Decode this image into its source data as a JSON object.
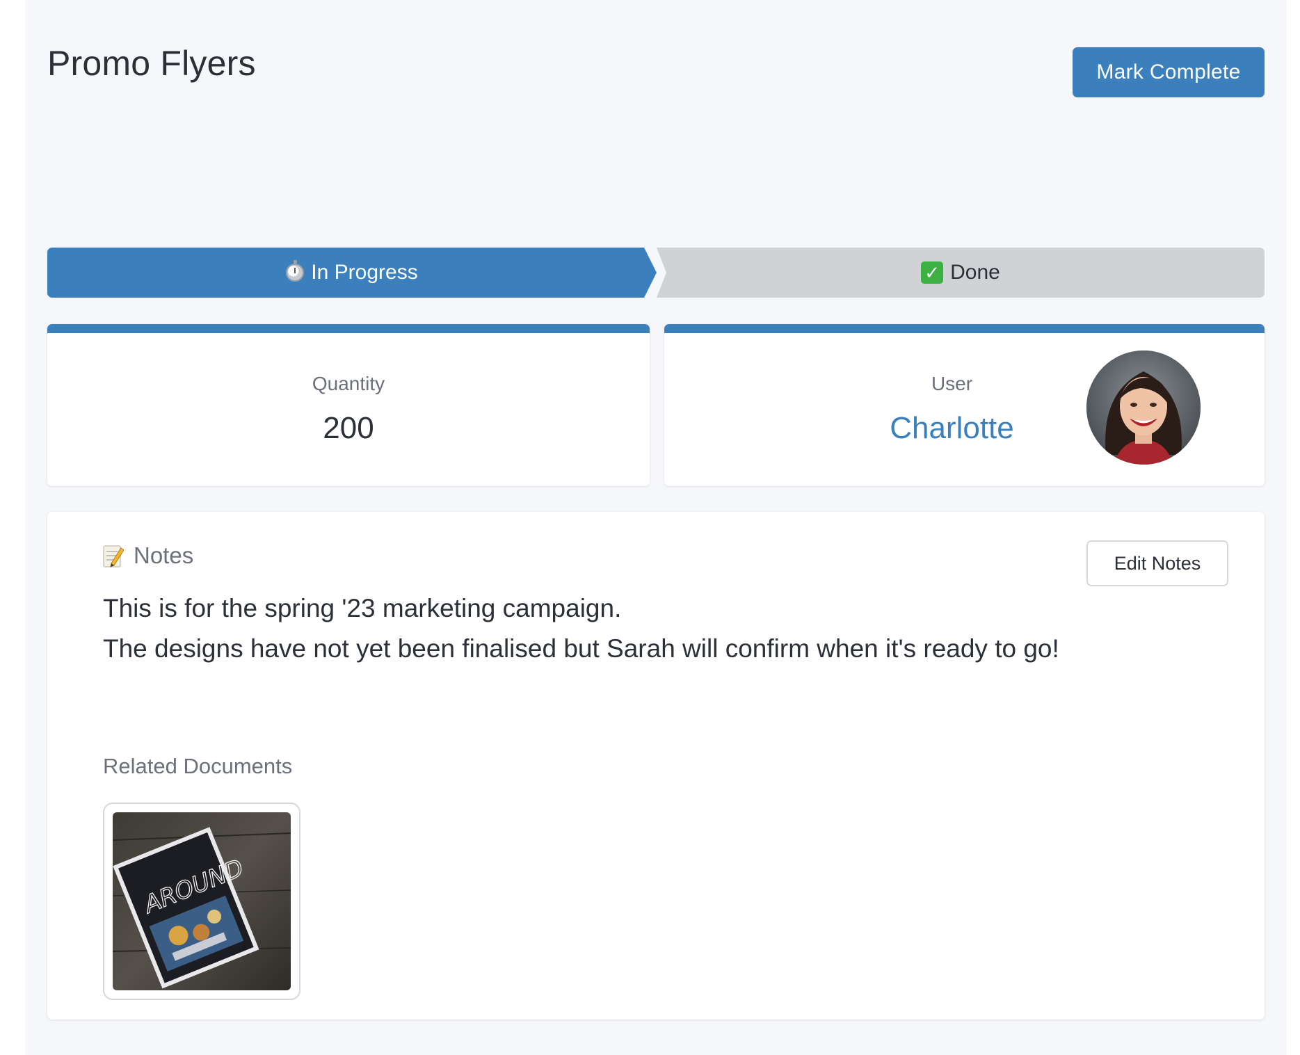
{
  "header": {
    "title": "Promo Flyers",
    "mark_complete_label": "Mark Complete"
  },
  "stepper": {
    "steps": [
      {
        "label": "In Progress",
        "icon": "stopwatch-icon",
        "active": true
      },
      {
        "label": "Done",
        "icon": "check-mark-icon",
        "active": false
      }
    ]
  },
  "stats": {
    "quantity_label": "Quantity",
    "quantity_value": "200",
    "user_label": "User",
    "user_name": "Charlotte",
    "user_avatar": "user-avatar-photo"
  },
  "notes": {
    "heading": "Notes",
    "heading_icon": "memo-icon",
    "edit_label": "Edit Notes",
    "lines": [
      "This is for the spring '23 marketing campaign.",
      "The designs have not yet been finalised but Sarah will confirm when it's ready to go!"
    ]
  },
  "related": {
    "heading": "Related Documents",
    "documents": [
      {
        "thumbnail": "magazine-thumbnail",
        "cover_text": "AROUND"
      }
    ]
  },
  "colors": {
    "accent": "#3b80bd",
    "step_inactive": "#d0d2d5",
    "page_background": "#f5f7fa",
    "card_background": "#ffffff",
    "muted_text": "#6b7079",
    "check_green": "#3cb043"
  }
}
